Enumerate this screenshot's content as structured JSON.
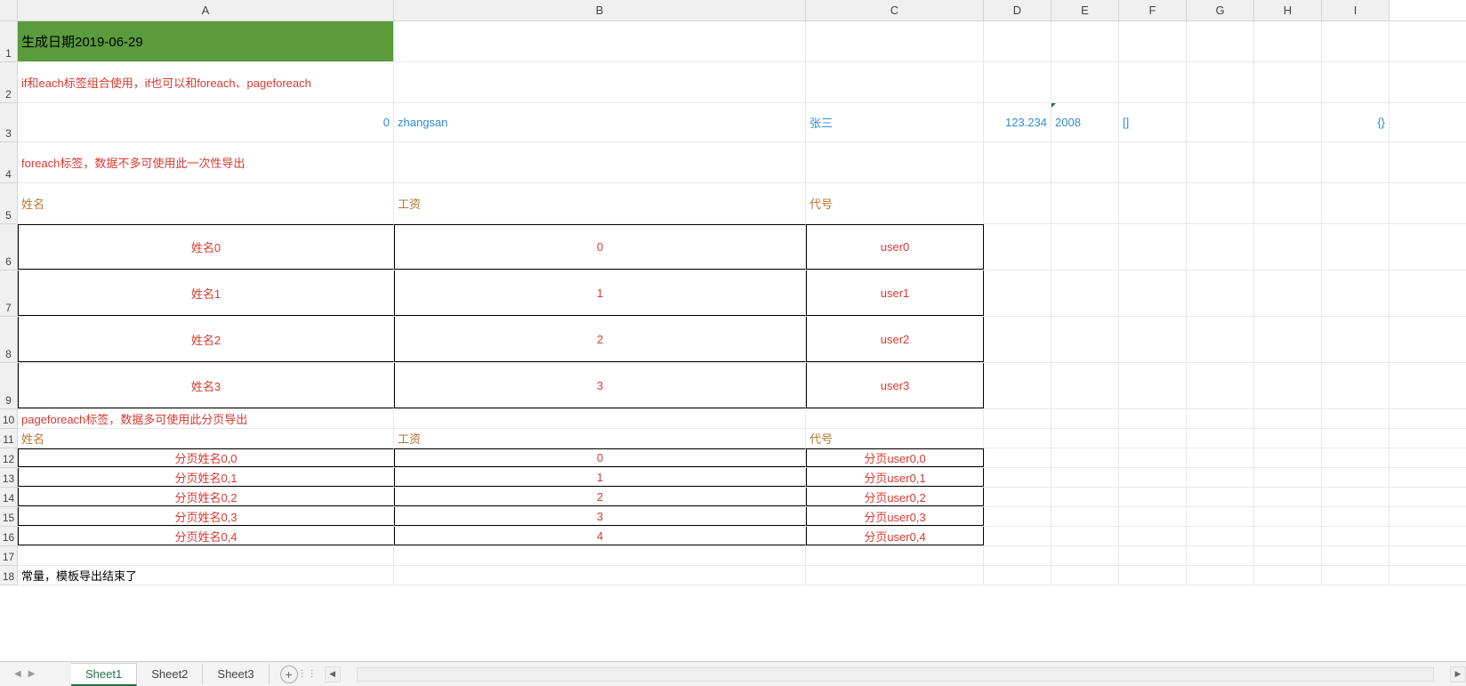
{
  "columns": [
    "A",
    "B",
    "C",
    "D",
    "E",
    "F",
    "G",
    "H",
    "I"
  ],
  "row1": {
    "a": "生成日期2019-06-29"
  },
  "row2": {
    "a": "if和each标签组合使用，if也可以和foreach、pageforeach"
  },
  "row3": {
    "a": "0",
    "b": "zhangsan",
    "c": "张三",
    "d": "123.234",
    "e": "2008",
    "f": "[]",
    "i": "{}"
  },
  "row4": {
    "a": "foreach标签，数据不多可使用此一次性导出"
  },
  "headers": {
    "name": "姓名",
    "salary": "工资",
    "code": "代号"
  },
  "table1": [
    {
      "name": "姓名0",
      "salary": "0",
      "code": "user0"
    },
    {
      "name": "姓名1",
      "salary": "1",
      "code": "user1"
    },
    {
      "name": "姓名2",
      "salary": "2",
      "code": "user2"
    },
    {
      "name": "姓名3",
      "salary": "3",
      "code": "user3"
    }
  ],
  "row10": {
    "a": "pageforeach标签，数据多可使用此分页导出"
  },
  "table2": [
    {
      "name": "分页姓名0,0",
      "salary": "0",
      "code": "分页user0,0"
    },
    {
      "name": "分页姓名0,1",
      "salary": "1",
      "code": "分页user0,1"
    },
    {
      "name": "分页姓名0,2",
      "salary": "2",
      "code": "分页user0,2"
    },
    {
      "name": "分页姓名0,3",
      "salary": "3",
      "code": "分页user0,3"
    },
    {
      "name": "分页姓名0,4",
      "salary": "4",
      "code": "分页user0,4"
    }
  ],
  "row18": {
    "a": "常量，模板导出结束了"
  },
  "sheets": {
    "s1": "Sheet1",
    "s2": "Sheet2",
    "s3": "Sheet3"
  },
  "icons": {
    "plus": "+",
    "left": "◀",
    "right": "▶"
  }
}
